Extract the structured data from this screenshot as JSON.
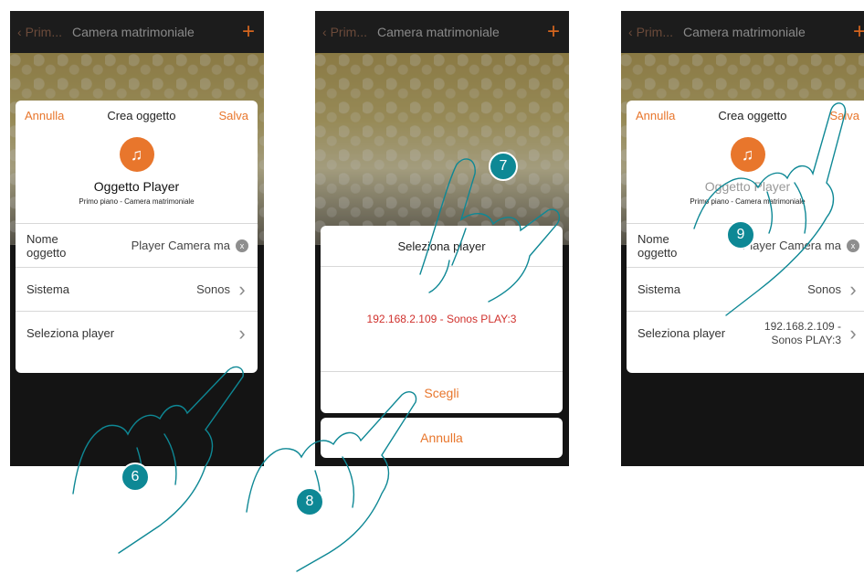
{
  "topbar": {
    "back": "Prim...",
    "title": "Camera matrimoniale",
    "plus": "+"
  },
  "dialog": {
    "cancel": "Annulla",
    "title": "Crea oggetto",
    "save": "Salva",
    "icon": "music-note-icon",
    "object_name": "Oggetto Player",
    "object_location": "Primo piano - Camera matrimoniale",
    "rows": {
      "name_label": "Nome oggetto",
      "name_value": "Player Camera ma",
      "system_label": "Sistema",
      "system_value": "Sonos",
      "player_label": "Seleziona player",
      "player_value": "192.168.2.109 - Sonos PLAY:3"
    }
  },
  "picker": {
    "title": "Seleziona player",
    "item": "192.168.2.109 - Sonos PLAY:3",
    "choose": "Scegli",
    "cancel": "Annulla"
  },
  "steps": [
    "6",
    "7",
    "8",
    "9"
  ],
  "colors": {
    "accent": "#e8762c",
    "step": "#0e8895",
    "selected": "#d0312d",
    "hand": "#0e8895"
  }
}
